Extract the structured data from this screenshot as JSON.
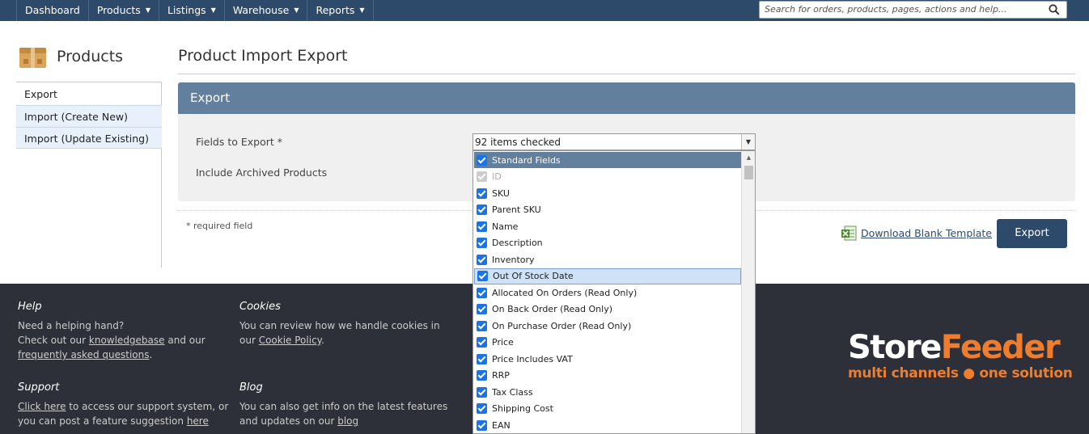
{
  "nav": {
    "items": [
      {
        "label": "Dashboard",
        "has_caret": false
      },
      {
        "label": "Products",
        "has_caret": true
      },
      {
        "label": "Listings",
        "has_caret": true
      },
      {
        "label": "Warehouse",
        "has_caret": true
      },
      {
        "label": "Reports",
        "has_caret": true
      }
    ],
    "search_placeholder": "Search for orders, products, pages, actions and help..."
  },
  "sidebar": {
    "title": "Products",
    "items": [
      {
        "label": "Export"
      },
      {
        "label": "Import (Create New)"
      },
      {
        "label": "Import (Update Existing)"
      }
    ]
  },
  "main": {
    "page_title": "Product Import Export",
    "panel_title": "Export",
    "fields_label": "Fields to Export *",
    "archived_label": "Include Archived Products",
    "select_value": "92 items checked",
    "required_note": "* required field",
    "download_link": "Download Blank Template",
    "export_button": "Export"
  },
  "dropdown": {
    "options": [
      {
        "label": "Standard Fields",
        "checked": true,
        "state": "selected"
      },
      {
        "label": "ID",
        "checked": true,
        "state": "disabled"
      },
      {
        "label": "SKU",
        "checked": true,
        "state": ""
      },
      {
        "label": "Parent SKU",
        "checked": true,
        "state": ""
      },
      {
        "label": "Name",
        "checked": true,
        "state": ""
      },
      {
        "label": "Description",
        "checked": true,
        "state": ""
      },
      {
        "label": "Inventory",
        "checked": true,
        "state": ""
      },
      {
        "label": "Out Of Stock Date",
        "checked": true,
        "state": "hover"
      },
      {
        "label": "Allocated On Orders (Read Only)",
        "checked": true,
        "state": ""
      },
      {
        "label": "On Back Order (Read Only)",
        "checked": true,
        "state": ""
      },
      {
        "label": "On Purchase Order (Read Only)",
        "checked": true,
        "state": ""
      },
      {
        "label": "Price",
        "checked": true,
        "state": ""
      },
      {
        "label": "Price Includes VAT",
        "checked": true,
        "state": ""
      },
      {
        "label": "RRP",
        "checked": true,
        "state": ""
      },
      {
        "label": "Tax Class",
        "checked": true,
        "state": ""
      },
      {
        "label": "Shipping Cost",
        "checked": true,
        "state": ""
      },
      {
        "label": "EAN",
        "checked": true,
        "state": ""
      }
    ]
  },
  "footer": {
    "help": {
      "title": "Help",
      "line1": "Need a helping hand?",
      "line2_pre": "Check out our ",
      "line2_link": "knowledgebase",
      "line2_post": " and our",
      "line3_link": "frequently asked questions",
      "line3_post": "."
    },
    "cookies": {
      "title": "Cookies",
      "line1": "You can review how we handle cookies in",
      "line2_pre": "our ",
      "line2_link": "Cookie Policy",
      "line2_post": "."
    },
    "support": {
      "title": "Support",
      "line1_link": "Click here",
      "line1_post": " to access our support system, or",
      "line2_pre": "you can post a feature suggestion ",
      "line2_link": "here"
    },
    "blog": {
      "title": "Blog",
      "line1": "You can also get info on the latest features",
      "line2_pre": "and updates on our ",
      "line2_link": "blog"
    },
    "logo": {
      "store": "Store",
      "feeder": "Feeder",
      "tagline": "multi channels ● one solution"
    }
  },
  "colors": {
    "nav_bg": "#2e4a6b",
    "panel_head": "#637f9e",
    "footer_bg": "#2d3038",
    "brand_orange": "#ef7d2d",
    "checkbox_blue": "#1a73e8"
  }
}
